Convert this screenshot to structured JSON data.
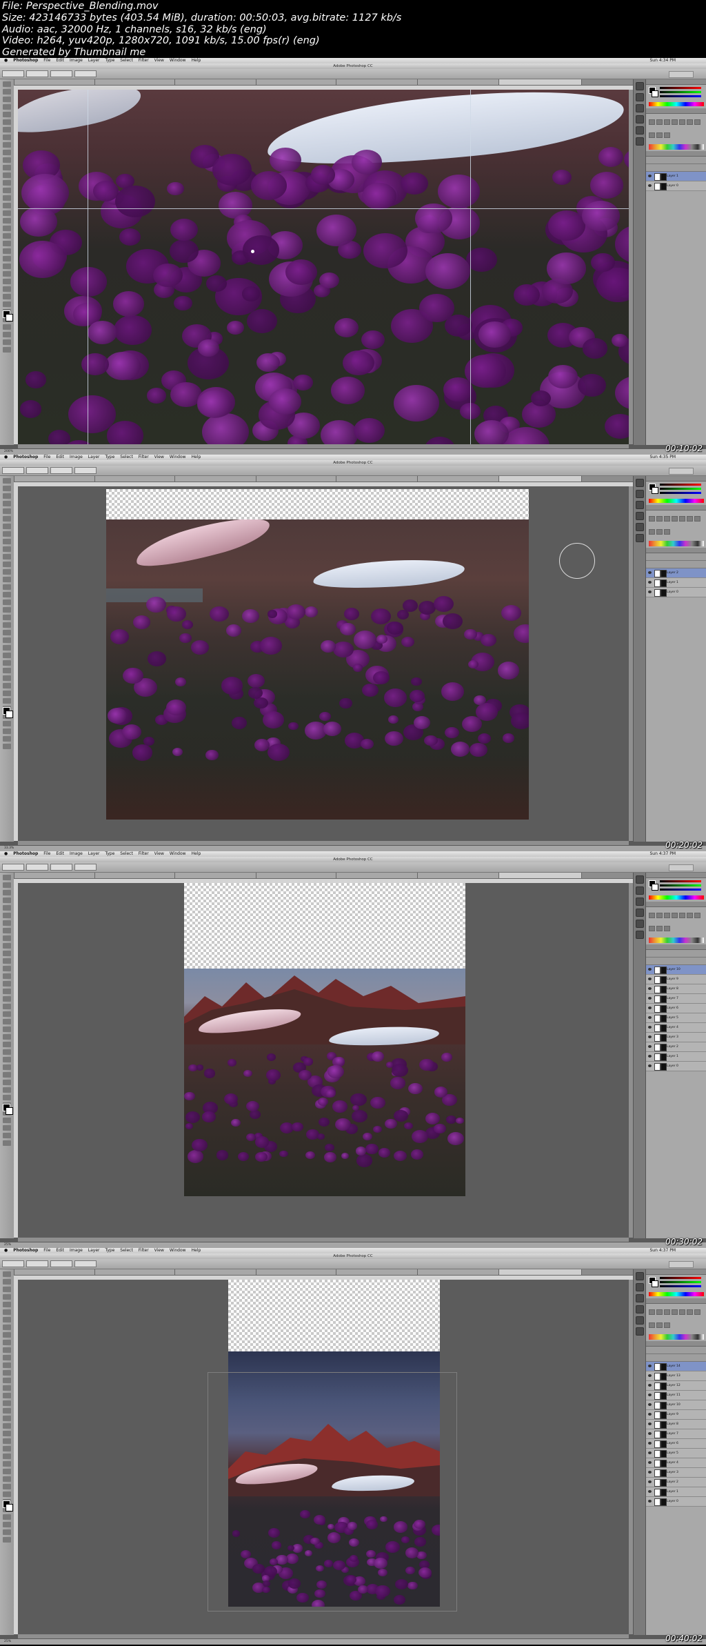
{
  "header": {
    "lines": [
      "File: Perspective_Blending.mov",
      "Size: 423146733 bytes (403.54 MiB), duration: 00:50:03, avg.bitrate: 1127 kb/s",
      "Audio: aac, 32000 Hz, 1 channels, s16, 32 kb/s (eng)",
      "Video: h264, yuv420p, 1280x720, 1091 kb/s, 15.00 fps(r) (eng)",
      "Generated by Thumbnail me"
    ]
  },
  "app": {
    "name": "Photoshop",
    "menus": [
      "File",
      "Edit",
      "Image",
      "Layer",
      "Type",
      "Select",
      "Filter",
      "View",
      "Window",
      "Help"
    ],
    "window_title": "Adobe Photoshop CC"
  },
  "frames": [
    {
      "timestamp": "00:10:02",
      "clock": "Sun 4:34 PM",
      "zoom": "200%",
      "layers": [
        "Layer 1",
        "Layer 0"
      ],
      "selected_layer": 0
    },
    {
      "timestamp": "00:20:02",
      "clock": "Sun 4:35 PM",
      "zoom": "33.3%",
      "layers": [
        "Layer 2",
        "Layer 1",
        "Layer 0"
      ],
      "selected_layer": 0
    },
    {
      "timestamp": "00:30:02",
      "clock": "Sun 4:37 PM",
      "zoom": "25%",
      "layers": [
        "Layer 10",
        "Layer 9",
        "Layer 8",
        "Layer 7",
        "Layer 6",
        "Layer 5",
        "Layer 4",
        "Layer 3",
        "Layer 2",
        "Layer 1",
        "Layer 0"
      ],
      "selected_layer": 0
    },
    {
      "timestamp": "00:40:02",
      "clock": "Sun 4:37 PM",
      "zoom": "25%",
      "layers": [
        "Layer 14",
        "Layer 13",
        "Layer 12",
        "Layer 11",
        "Layer 10",
        "Layer 9",
        "Layer 8",
        "Layer 7",
        "Layer 6",
        "Layer 5",
        "Layer 4",
        "Layer 3",
        "Layer 2",
        "Layer 1",
        "Layer 0"
      ],
      "selected_layer": 0
    }
  ]
}
